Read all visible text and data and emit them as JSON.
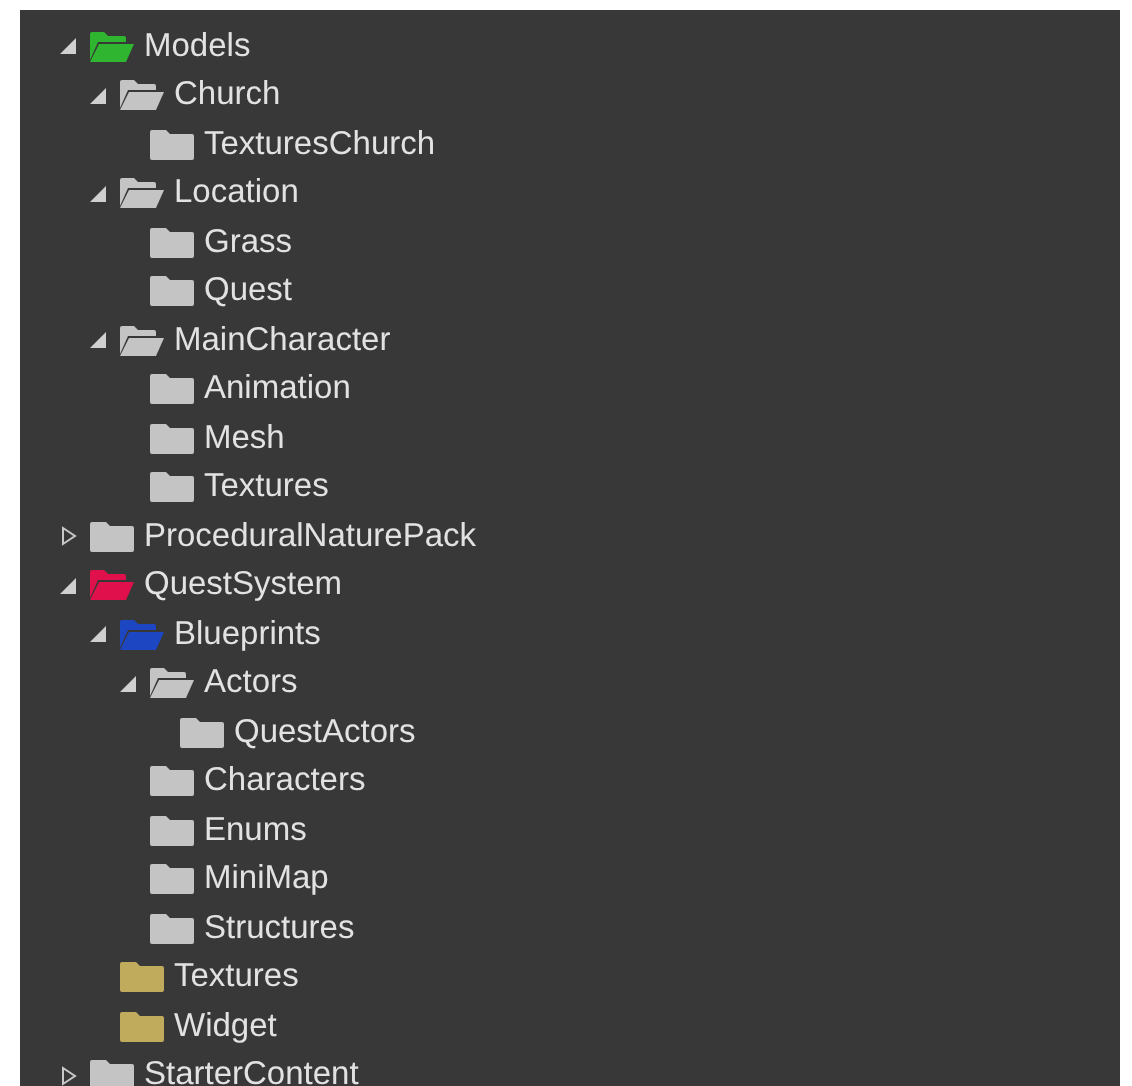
{
  "tree": [
    {
      "label": "Models",
      "kind": "branch",
      "expanded": true,
      "color": "#2fb52f",
      "children": [
        {
          "label": "Church",
          "kind": "branch",
          "expanded": true,
          "color": "#c4c4c4",
          "children": [
            {
              "label": "TexturesChurch",
              "kind": "leaf",
              "expanded": false,
              "color": "#c4c4c4"
            }
          ]
        },
        {
          "label": "Location",
          "kind": "branch",
          "expanded": true,
          "color": "#c4c4c4",
          "children": [
            {
              "label": "Grass",
              "kind": "leaf",
              "expanded": false,
              "color": "#c4c4c4"
            },
            {
              "label": "Quest",
              "kind": "leaf",
              "expanded": false,
              "color": "#c4c4c4"
            }
          ]
        },
        {
          "label": "MainCharacter",
          "kind": "branch",
          "expanded": true,
          "color": "#c4c4c4",
          "children": [
            {
              "label": "Animation",
              "kind": "leaf",
              "expanded": false,
              "color": "#c4c4c4"
            },
            {
              "label": "Mesh",
              "kind": "leaf",
              "expanded": false,
              "color": "#c4c4c4"
            },
            {
              "label": "Textures",
              "kind": "leaf",
              "expanded": false,
              "color": "#c4c4c4"
            }
          ]
        }
      ]
    },
    {
      "label": "ProceduralNaturePack",
      "kind": "branch",
      "expanded": false,
      "color": "#c4c4c4"
    },
    {
      "label": "QuestSystem",
      "kind": "branch",
      "expanded": true,
      "color": "#e0104c",
      "children": [
        {
          "label": "Blueprints",
          "kind": "branch",
          "expanded": true,
          "color": "#1d47c2",
          "children": [
            {
              "label": "Actors",
              "kind": "branch",
              "expanded": true,
              "color": "#c4c4c4",
              "children": [
                {
                  "label": "QuestActors",
                  "kind": "leaf",
                  "expanded": false,
                  "color": "#c4c4c4"
                }
              ]
            },
            {
              "label": "Characters",
              "kind": "leaf",
              "expanded": false,
              "color": "#c4c4c4"
            },
            {
              "label": "Enums",
              "kind": "leaf",
              "expanded": false,
              "color": "#c4c4c4"
            },
            {
              "label": "MiniMap",
              "kind": "leaf",
              "expanded": false,
              "color": "#c4c4c4"
            },
            {
              "label": "Structures",
              "kind": "leaf",
              "expanded": false,
              "color": "#c4c4c4"
            }
          ]
        },
        {
          "label": "Textures",
          "kind": "leaf",
          "expanded": false,
          "color": "#c0aa5c"
        },
        {
          "label": "Widget",
          "kind": "leaf",
          "expanded": false,
          "color": "#c0aa5c"
        }
      ]
    },
    {
      "label": "StarterContent",
      "kind": "branch",
      "expanded": false,
      "color": "#c4c4c4"
    }
  ]
}
